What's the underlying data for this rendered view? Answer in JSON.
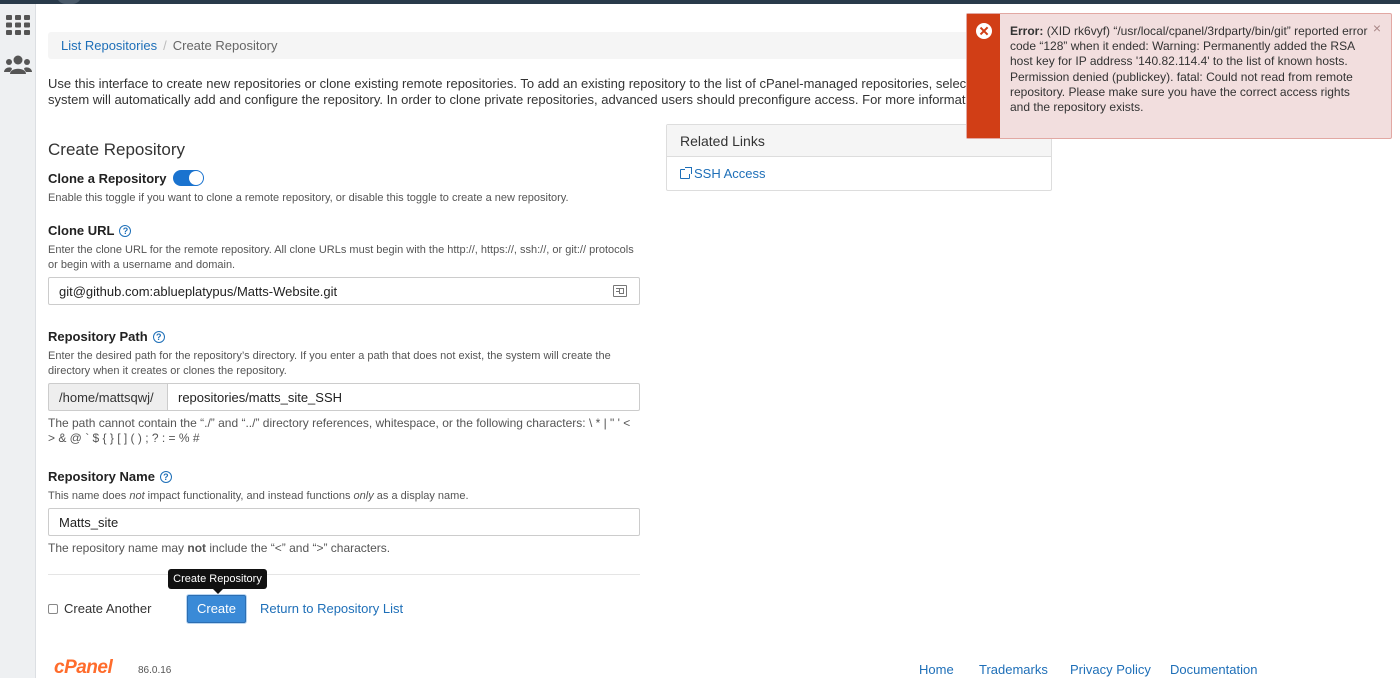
{
  "breadcrumb": {
    "items": [
      "List Repositories",
      "Create Repository"
    ],
    "separator": "/"
  },
  "intro": {
    "line1": "Use this interface to create new repositories or clone existing remote repositories. To add an existing repository to the list of cPanel-managed repositories, select that",
    "line2": "system will automatically add and configure the repository. In order to clone private repositories, advanced users should preconfigure access. For more information, r"
  },
  "form": {
    "heading": "Create Repository",
    "clone": {
      "label": "Clone a Repository",
      "enabled": true,
      "help": "Enable this toggle if you want to clone a remote repository, or disable this toggle to create a new repository."
    },
    "clone_url": {
      "label": "Clone URL",
      "help": "Enter the clone URL for the remote repository. All clone URLs must begin with the http://, https://, ssh://, or git:// protocols or begin with a username and domain.",
      "value": "git@github.com:ablueplatypus/Matts-Website.git"
    },
    "repo_path": {
      "label": "Repository Path",
      "help": "Enter the desired path for the repository’s directory. If you enter a path that does not exist, the system will create the directory when it creates or clones the repository.",
      "prefix": "/home/mattsqwj/",
      "value": "repositories/matts_site_SSH",
      "note": "The path cannot contain the “./” and “../” directory references, whitespace, or the following characters: \\ * | \" ' < > & @ ` $ { } [ ] ( ) ; ? : = % #"
    },
    "repo_name": {
      "label": "Repository Name",
      "help_part1": "This name does ",
      "help_em1": "not",
      "help_part2": " impact functionality, and instead functions ",
      "help_em2": "only",
      "help_part3": " as a display name.",
      "value": "Matts_site",
      "note_part1": "The repository name may ",
      "note_bold": "not",
      "note_part2": " include the “<” and “>” characters."
    },
    "create_another_label": "Create Another",
    "create_button": "Create",
    "create_tooltip": "Create Repository",
    "return_link": "Return to Repository List"
  },
  "related_links": {
    "title": "Related Links",
    "items": [
      {
        "label": "SSH Access",
        "icon": "external-link-icon"
      }
    ]
  },
  "alert": {
    "title": "Error:",
    "message": "(XID rk6vyf) “/usr/local/cpanel/3rdparty/bin/git” reported error code “128” when it ended: Warning: Permanently added the RSA host key for IP address '140.82.114.4' to the list of known hosts. Permission denied (publickey). fatal: Could not read from remote repository. Please make sure you have the correct access rights and the repository exists.",
    "close": "×",
    "color": "#d13e16"
  },
  "footer": {
    "logo": "cPanel",
    "version": "86.0.16",
    "links": [
      "Home",
      "Trademarks",
      "Privacy Policy",
      "Documentation"
    ]
  },
  "colors": {
    "accent": "#1e6fb8",
    "primary_button": "#3a8ad7",
    "brand": "#ff6c2c"
  }
}
